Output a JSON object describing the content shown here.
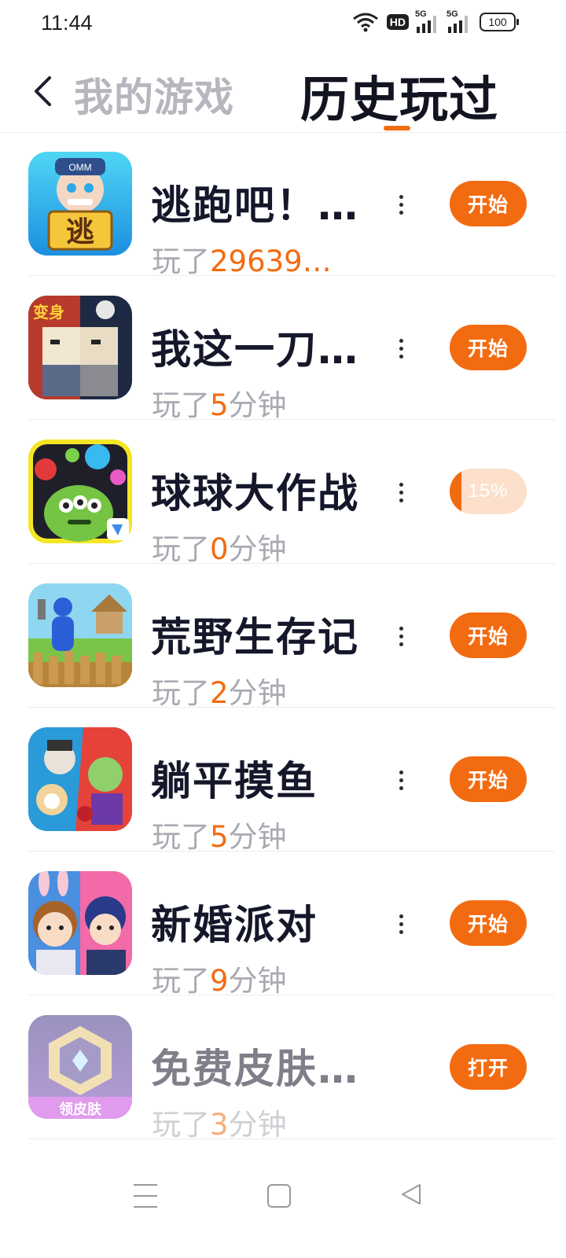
{
  "status": {
    "time": "11:44",
    "hd": "HD",
    "sim1": "5G",
    "sim2": "5G",
    "battery": "100"
  },
  "header": {
    "tab_inactive": "我的游戏",
    "tab_active": "历史玩过"
  },
  "colors": {
    "accent": "#f36b11",
    "title": "#15172a",
    "muted": "#a9aab2"
  },
  "games": [
    {
      "title": "逃跑吧！…",
      "played_prefix": "玩了",
      "played_num": "29639…",
      "played_suffix": "",
      "button": "开始",
      "icon": "escape-game-icon"
    },
    {
      "title": "我这一刀…",
      "played_prefix": "玩了",
      "played_num": "5",
      "played_suffix": "分钟",
      "button": "开始",
      "icon": "blade-game-icon"
    },
    {
      "title": "球球大作战",
      "played_prefix": "玩了",
      "played_num": "0",
      "played_suffix": "分钟",
      "button": "15%",
      "progress": 0.15,
      "icon": "ball-battle-game-icon"
    },
    {
      "title": "荒野生存记",
      "played_prefix": "玩了",
      "played_num": "2",
      "played_suffix": "分钟",
      "button": "开始",
      "icon": "wild-survival-game-icon"
    },
    {
      "title": "躺平摸鱼",
      "played_prefix": "玩了",
      "played_num": "5",
      "played_suffix": "分钟",
      "button": "开始",
      "icon": "lie-flat-game-icon"
    },
    {
      "title": "新婚派对",
      "played_prefix": "玩了",
      "played_num": "9",
      "played_suffix": "分钟",
      "button": "开始",
      "icon": "wedding-party-game-icon"
    },
    {
      "title": "免费皮肤…",
      "played_prefix": "玩了",
      "played_num": "3",
      "played_suffix": "分钟",
      "button": "打开",
      "icon": "free-skin-app-icon"
    }
  ]
}
